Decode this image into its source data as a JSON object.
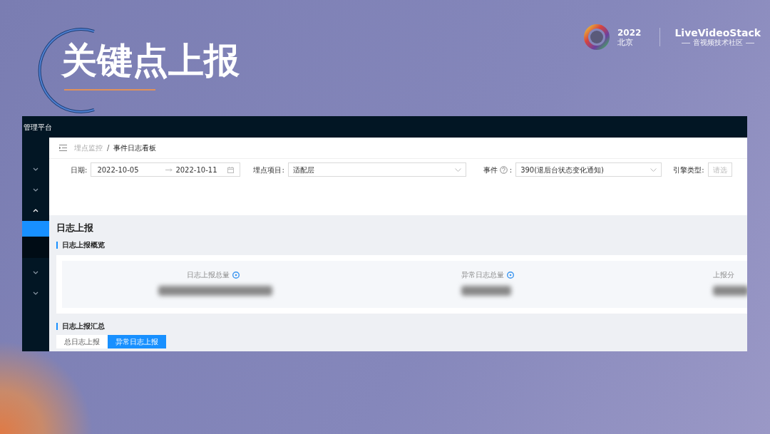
{
  "slide": {
    "title": "关键点上报",
    "logo": {
      "year": "2022",
      "city": "北京",
      "brand": "LiveVideoStack",
      "tagline": "音视频技术社区"
    }
  },
  "app": {
    "title": "管理平台",
    "sidebar": {
      "items": [
        {
          "expanded": false
        },
        {
          "expanded": false
        },
        {
          "expanded": true,
          "children": [
            {
              "selected": true
            },
            {
              "selected": false
            }
          ]
        },
        {
          "expanded": false
        },
        {
          "expanded": false
        }
      ]
    },
    "breadcrumb": [
      {
        "label": "埋点监控",
        "current": false
      },
      {
        "label": "事件日志看板",
        "current": true
      }
    ],
    "breadcrumb_separator": "/",
    "filters": [
      {
        "kind": "daterange",
        "label": "日期:",
        "start": "2022-10-05",
        "end": "2022-10-11"
      },
      {
        "kind": "select",
        "label": "埋点项目:",
        "value": "适配层",
        "help": false
      },
      {
        "kind": "select",
        "label": "事件",
        "suffix": ":",
        "value": "390(退后台状态变化通知)",
        "help": true
      },
      {
        "kind": "select",
        "label": "引擎类型:",
        "placeholder": "请选",
        "help": false
      }
    ],
    "page_title": "日志上报",
    "overview": {
      "title": "日志上报概览",
      "stats": [
        {
          "label": "日志上报总量",
          "help": true
        },
        {
          "label": "异常日志总量",
          "help": true
        },
        {
          "label": "上报分",
          "help": false
        }
      ]
    },
    "summary": {
      "title": "日志上报汇总",
      "tabs": [
        {
          "label": "总日志上报",
          "selected": false
        },
        {
          "label": "异常日志上报",
          "selected": true
        }
      ]
    }
  }
}
